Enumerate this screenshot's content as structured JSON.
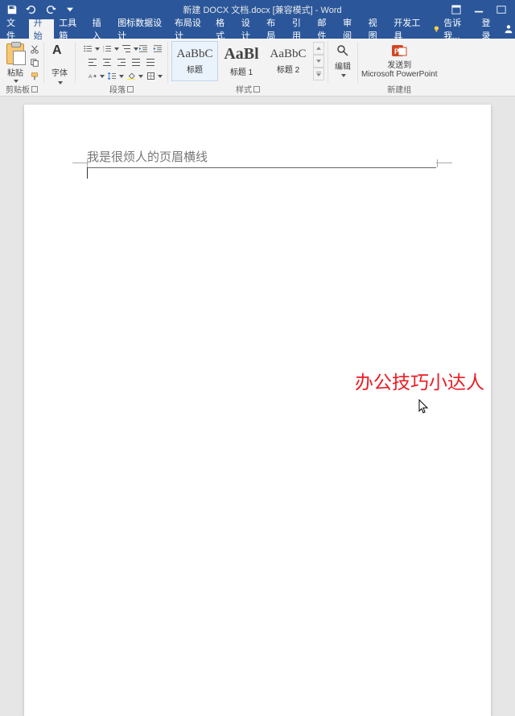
{
  "titlebar": {
    "doc_title": "新建 DOCX 文档.docx [兼容模式] - Word"
  },
  "tabs": {
    "file": "文件",
    "home": "开始",
    "toolbox": "工具箱",
    "insert": "插入",
    "icon_data_design": "图标数据设计",
    "layout_design": "布局设计",
    "format": "格式",
    "design": "设计",
    "layout": "布局",
    "references": "引用",
    "mailings": "邮件",
    "review": "审阅",
    "view": "视图",
    "developer": "开发工具",
    "tell_me": "告诉我...",
    "login": "登录"
  },
  "ribbon": {
    "clipboard": {
      "paste": "粘贴",
      "label": "剪贴板"
    },
    "font": {
      "label": "字体"
    },
    "paragraph": {
      "label": "段落"
    },
    "styles": {
      "label": "样式",
      "items": [
        {
          "preview": "AaBbC",
          "name": "标题",
          "size": "15px",
          "weight": "normal"
        },
        {
          "preview": "AaBl",
          "name": "标题 1",
          "size": "20px",
          "weight": "bold"
        },
        {
          "preview": "AaBbC",
          "name": "标题 2",
          "size": "15px",
          "weight": "normal"
        }
      ]
    },
    "editing": {
      "label": "编辑"
    },
    "send": {
      "button": "发送到",
      "target": "Microsoft PowerPoint",
      "label": "新建组"
    }
  },
  "document": {
    "header_text": "我是很烦人的页眉横线"
  },
  "watermark": "办公技巧小达人"
}
